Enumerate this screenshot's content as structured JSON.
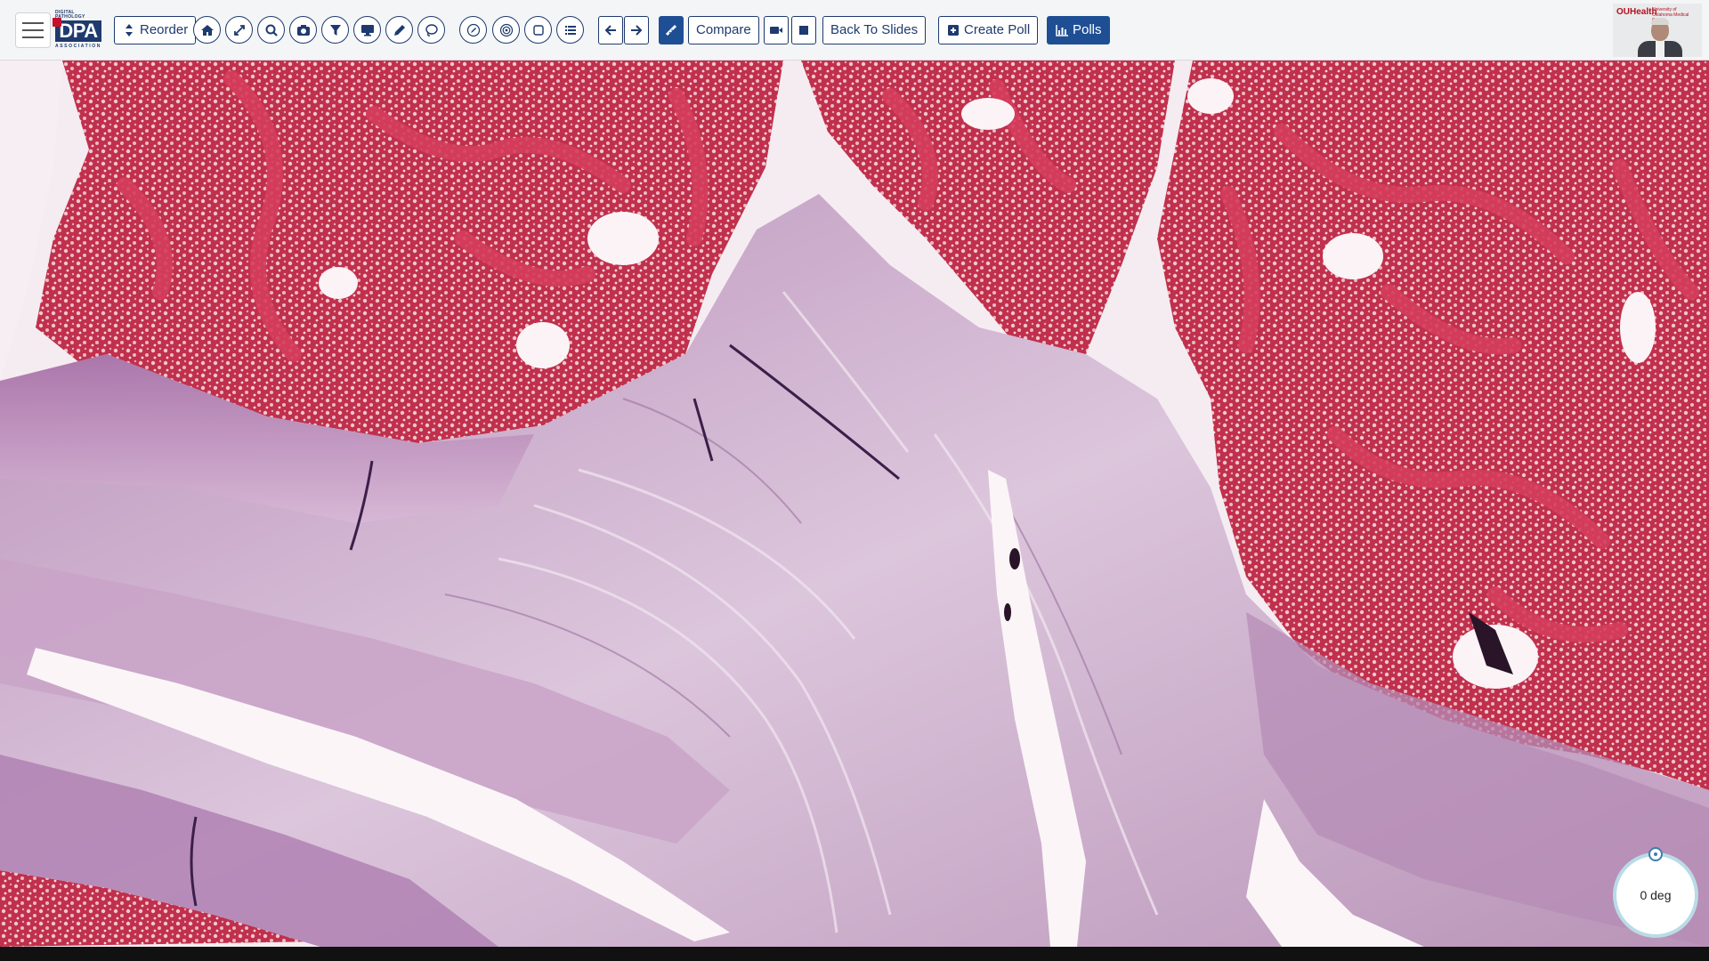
{
  "toolbar": {
    "logo": {
      "small_text": "DIGITAL PATHOLOGY",
      "big_text": "DPA",
      "assoc_text": "ASSOCIATION"
    },
    "reorder_label": "Reorder",
    "compare_label": "Compare",
    "back_label": "Back To Slides",
    "create_poll_label": "Create Poll",
    "polls_label": "Polls",
    "icons": [
      "home-icon",
      "expand-icon",
      "zoom-icon",
      "camera-icon",
      "filter-icon",
      "monitor-icon",
      "pencil-icon",
      "lasso-icon",
      "draw-icon",
      "target-icon",
      "square-icon",
      "list-icon",
      "arrow-left-icon",
      "arrow-right-icon",
      "ruler-icon",
      "video-icon",
      "stop-icon"
    ]
  },
  "webcam": {
    "brand": "OUHealth",
    "subtitle": "University of Oklahoma Medical Center"
  },
  "viewer": {
    "rotation_label": "0 deg"
  },
  "colors": {
    "accent": "#1e4f94",
    "border": "#1e3a6e",
    "marrow": "#c4334f",
    "cartilage": "#c9a6c6"
  }
}
